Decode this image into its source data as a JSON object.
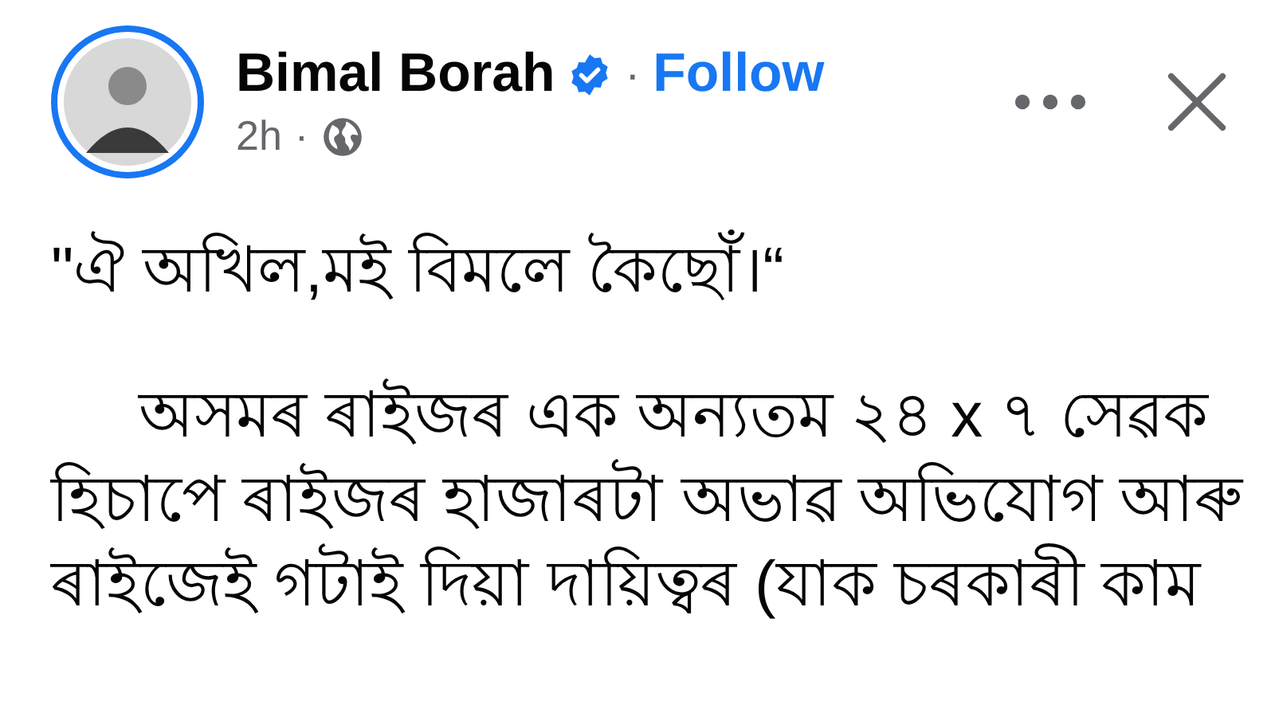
{
  "post": {
    "author": "Bimal Borah",
    "verified": true,
    "separator": "·",
    "follow": "Follow",
    "time": "2h",
    "time_separator": "·",
    "public": true
  },
  "body": {
    "quote": "\"ঐ অখিল,মই বিমলে কৈছোঁ।“",
    "paragraph_lines": [
      "অসমৰ ৰাইজৰ এক অন্যতম ২৪ x ৭ সেৱক",
      "হিচাপে ৰাইজৰ হাজাৰটা অভাৱ অভিযোগ আৰু",
      "ৰাইজেই গটাই দিয়া দায়িত্বৰ (যাক চৰকাৰী কাম"
    ]
  }
}
